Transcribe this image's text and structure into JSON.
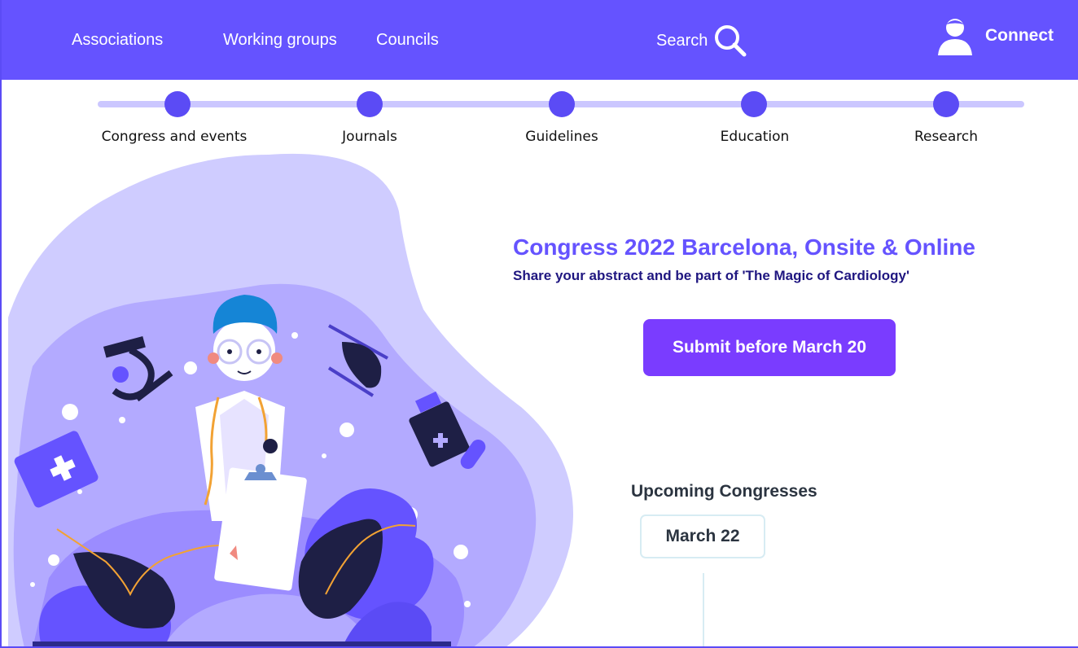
{
  "nav": {
    "links": [
      "Associations",
      "Working groups",
      "Councils"
    ],
    "search_label": "Search",
    "connect_label": "Connect"
  },
  "steps": [
    "Congress and events",
    "Journals",
    "Guidelines",
    "Education",
    "Research"
  ],
  "hero": {
    "title": "Congress 2022 Barcelona, Onsite & Online",
    "subtitle": "Share your abstract and be part of 'The Magic of Cardiology'",
    "cta_label": "Submit before March 20"
  },
  "upcoming": {
    "title": "Upcoming Congresses",
    "date": "March 22"
  },
  "colors": {
    "brand": "#6553ff",
    "button": "#7a3cff",
    "step_dot": "#5b4bf5",
    "step_line": "#cbc7ff",
    "illustration_light": "#cfccff",
    "illustration_mid": "#9b8cff",
    "illustration_dark": "#1e1f45"
  },
  "icons": {
    "search": "search-icon",
    "user": "user-icon"
  }
}
